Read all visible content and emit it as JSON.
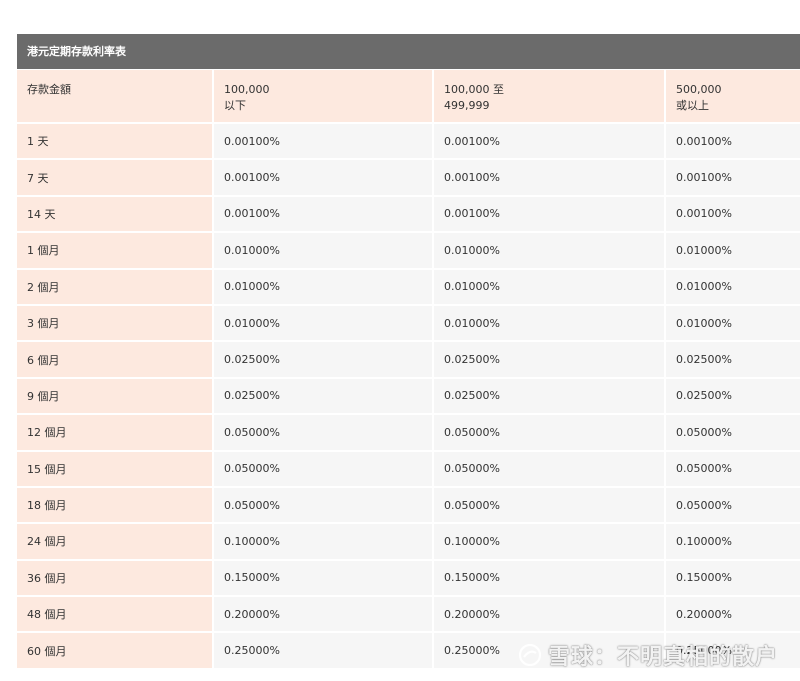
{
  "table": {
    "title": "港元定期存款利率表",
    "headers": [
      {
        "line1": "存款金額",
        "line2": ""
      },
      {
        "line1": "100,000",
        "line2": "以下"
      },
      {
        "line1": "100,000 至",
        "line2": "499,999"
      },
      {
        "line1": "500,000",
        "line2": "或以上"
      }
    ],
    "rows": [
      {
        "term": "1 天",
        "rates": [
          "0.00100%",
          "0.00100%",
          "0.00100%"
        ]
      },
      {
        "term": "7 天",
        "rates": [
          "0.00100%",
          "0.00100%",
          "0.00100%"
        ]
      },
      {
        "term": "14 天",
        "rates": [
          "0.00100%",
          "0.00100%",
          "0.00100%"
        ]
      },
      {
        "term": "1 個月",
        "rates": [
          "0.01000%",
          "0.01000%",
          "0.01000%"
        ]
      },
      {
        "term": "2 個月",
        "rates": [
          "0.01000%",
          "0.01000%",
          "0.01000%"
        ]
      },
      {
        "term": "3 個月",
        "rates": [
          "0.01000%",
          "0.01000%",
          "0.01000%"
        ]
      },
      {
        "term": "6 個月",
        "rates": [
          "0.02500%",
          "0.02500%",
          "0.02500%"
        ]
      },
      {
        "term": "9 個月",
        "rates": [
          "0.02500%",
          "0.02500%",
          "0.02500%"
        ]
      },
      {
        "term": "12 個月",
        "rates": [
          "0.05000%",
          "0.05000%",
          "0.05000%"
        ]
      },
      {
        "term": "15 個月",
        "rates": [
          "0.05000%",
          "0.05000%",
          "0.05000%"
        ]
      },
      {
        "term": "18 個月",
        "rates": [
          "0.05000%",
          "0.05000%",
          "0.05000%"
        ]
      },
      {
        "term": "24 個月",
        "rates": [
          "0.10000%",
          "0.10000%",
          "0.10000%"
        ]
      },
      {
        "term": "36 個月",
        "rates": [
          "0.15000%",
          "0.15000%",
          "0.15000%"
        ]
      },
      {
        "term": "48 個月",
        "rates": [
          "0.20000%",
          "0.20000%",
          "0.20000%"
        ]
      },
      {
        "term": "60 個月",
        "rates": [
          "0.25000%",
          "0.25000%",
          "0.25000%"
        ]
      }
    ]
  },
  "watermark": {
    "text": "雪球：不明真相的散户",
    "icon": "snowball-logo-icon"
  },
  "colors": {
    "title_bg": "#6b6b6b",
    "header_bg": "#fde9df",
    "cell_bg": "#f6f6f6"
  }
}
